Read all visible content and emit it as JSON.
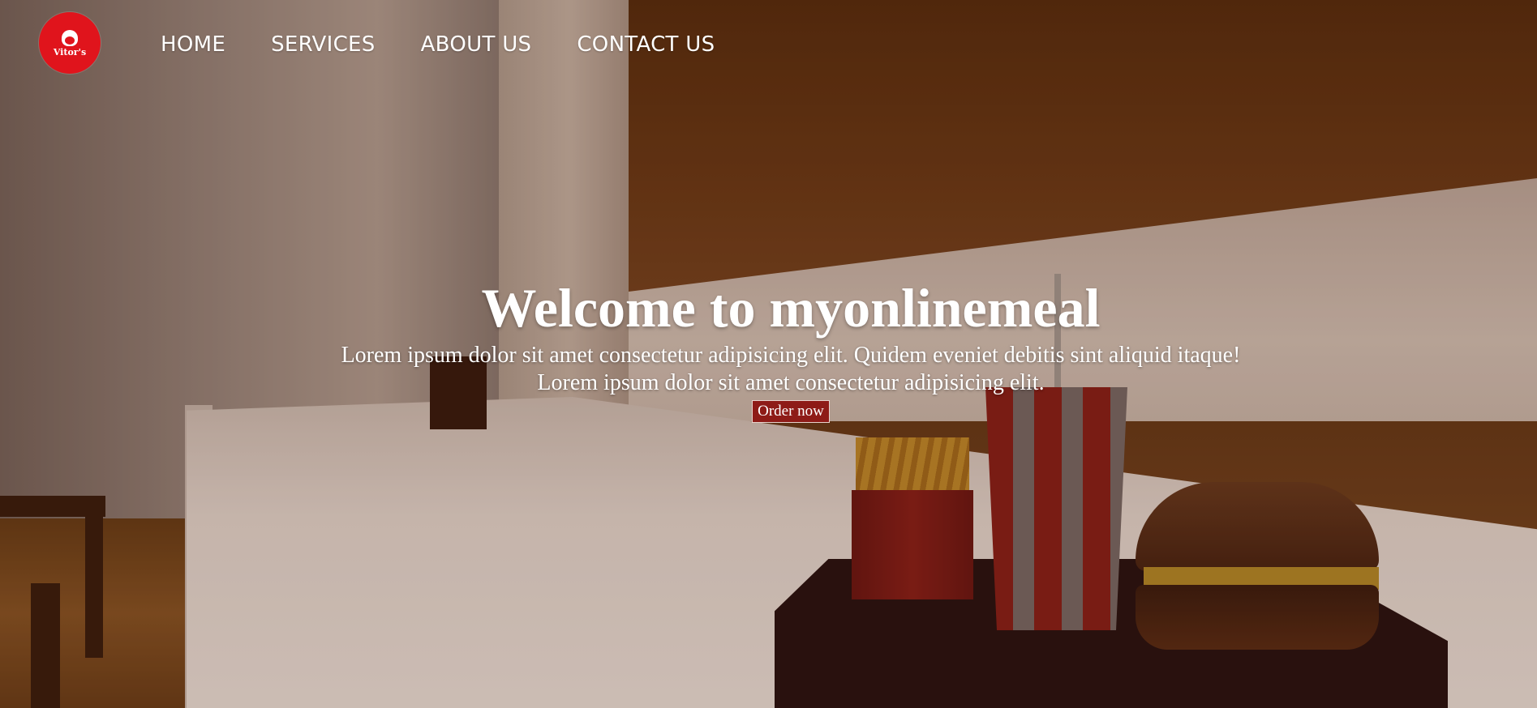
{
  "brand": {
    "logo_text": "Vitor's",
    "logo_color": "#e0141c"
  },
  "nav": {
    "items": [
      {
        "label": "HOME"
      },
      {
        "label": "SERVICES"
      },
      {
        "label": "ABOUT US"
      },
      {
        "label": "CONTACT US"
      }
    ]
  },
  "hero": {
    "title": "Welcome to myonlinemeal",
    "line1": "Lorem ipsum dolor sit amet consectetur adipisicing elit. Quidem eveniet debitis sint aliquid itaque!",
    "line2": "Lorem ipsum dolor sit amet consectetur adipisicing elit.",
    "button_label": "Order now",
    "button_color": "#8e1b17"
  }
}
